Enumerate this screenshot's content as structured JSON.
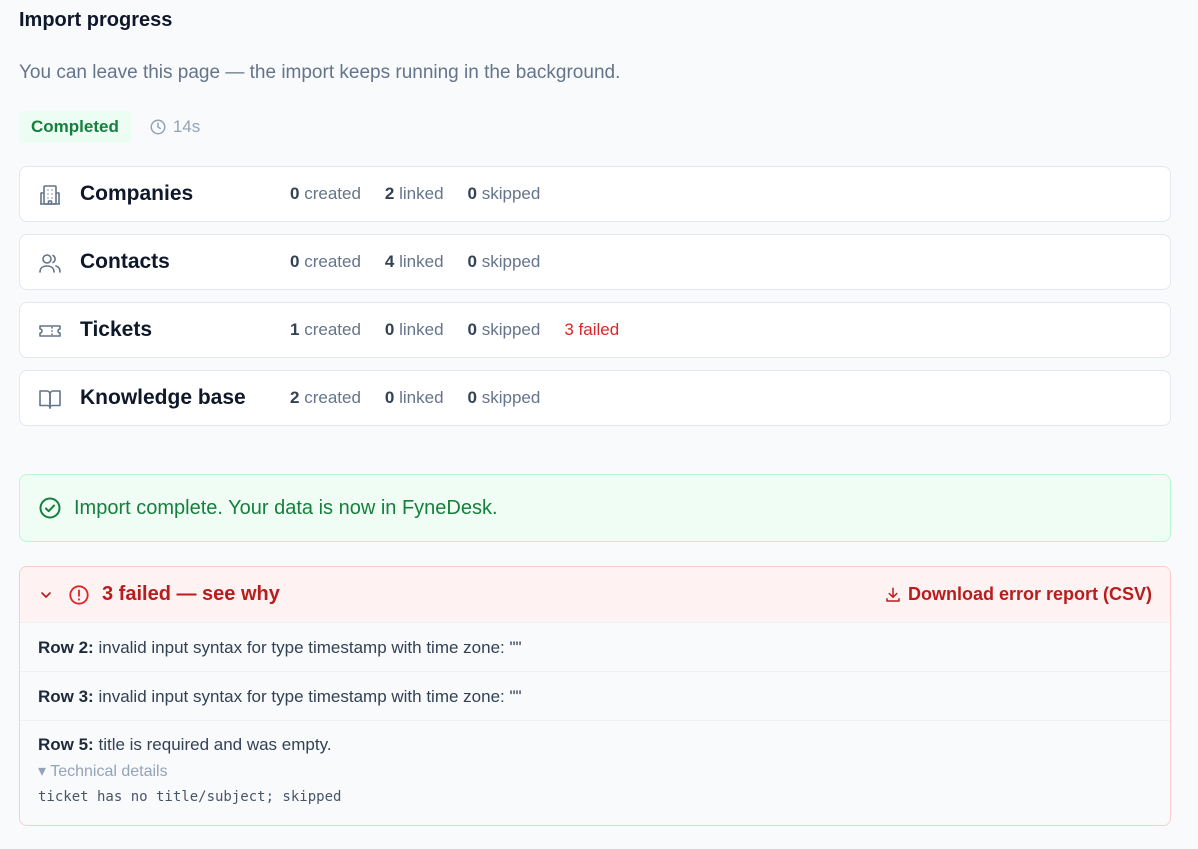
{
  "header": {
    "title": "Import progress",
    "subtitle": "You can leave this page — the import keeps running in the background."
  },
  "status": {
    "badge": "Completed",
    "duration": "14s"
  },
  "entities": [
    {
      "name": "Companies",
      "icon": "building-icon",
      "created": "0",
      "linked": "2",
      "skipped": "0",
      "failed": ""
    },
    {
      "name": "Contacts",
      "icon": "users-icon",
      "created": "0",
      "linked": "4",
      "skipped": "0",
      "failed": ""
    },
    {
      "name": "Tickets",
      "icon": "ticket-icon",
      "created": "1",
      "linked": "0",
      "skipped": "0",
      "failed": "3"
    },
    {
      "name": "Knowledge base",
      "icon": "book-icon",
      "created": "2",
      "linked": "0",
      "skipped": "0",
      "failed": ""
    }
  ],
  "labels": {
    "created": "created",
    "linked": "linked",
    "skipped": "skipped",
    "failed": "failed"
  },
  "success": {
    "message": "Import complete. Your data is now in FyneDesk."
  },
  "errors": {
    "title": "3 failed — see why",
    "download_label": "Download error report (CSV)",
    "rows": [
      {
        "label": "Row 2:",
        "message": "invalid input syntax for type timestamp with time zone: \"\""
      },
      {
        "label": "Row 3:",
        "message": "invalid input syntax for type timestamp with time zone: \"\""
      },
      {
        "label": "Row 5:",
        "message": "title is required and was empty.",
        "details_label": "▾ Technical details",
        "details": "ticket has no title/subject; skipped"
      }
    ]
  },
  "colors": {
    "success": "#15803d",
    "danger": "#b91c1c",
    "muted": "#64748b"
  }
}
